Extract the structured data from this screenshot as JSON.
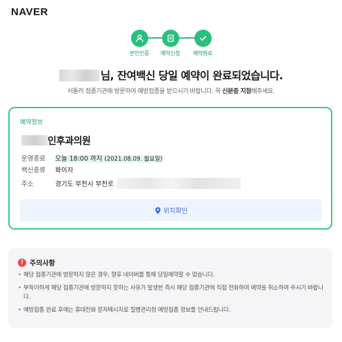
{
  "logo": "NAVER",
  "steps": [
    {
      "label": "본인인증",
      "icon": "person-icon"
    },
    {
      "label": "예약신청",
      "icon": "document-icon"
    },
    {
      "label": "예약완료",
      "icon": "check-icon"
    }
  ],
  "headline": "님, 잔여백신 당일 예약이 완료되었습니다.",
  "subtitle": {
    "before": "서둘러 접종기관에 방문하여 예방접종을 받으시기 바랍니다. 꼭 ",
    "bold": "신분증 지참",
    "after": "해주세요."
  },
  "reservation": {
    "section_label": "예약정보",
    "clinic_name_suffix": "인후과의원",
    "hours_label": "운영종료",
    "hours_value": "오늘 18:00 까지",
    "hours_date": "(2021.08.09. 월요일)",
    "vaccine_label": "백신종류",
    "vaccine_value": "화이자",
    "address_label": "주소",
    "address_value": "경기도 부천시 부천로",
    "location_button": "위치확인"
  },
  "notice": {
    "title": "주의사항",
    "items": [
      "해당 접종기관에 방문하지 않은 경우, 향후 네이버를 통해 당일예약할 수 없습니다.",
      "부득이하게 해당 접종기관에 방문하지 못하는 사유가 발생한 즉시 해당 접종기관에 직접 전화하여 예약을 취소하여 주시기 바랍니다.",
      "예방접종 완료 후에는 휴대전화 문자메시지로 질병관리청 예방접종 정보를 안내드립니다."
    ]
  },
  "colors": {
    "accent_green": "#2bbf7e",
    "card_border": "#3cc68a",
    "link_blue": "#3b6fd1",
    "warning_red": "#ee4646"
  }
}
